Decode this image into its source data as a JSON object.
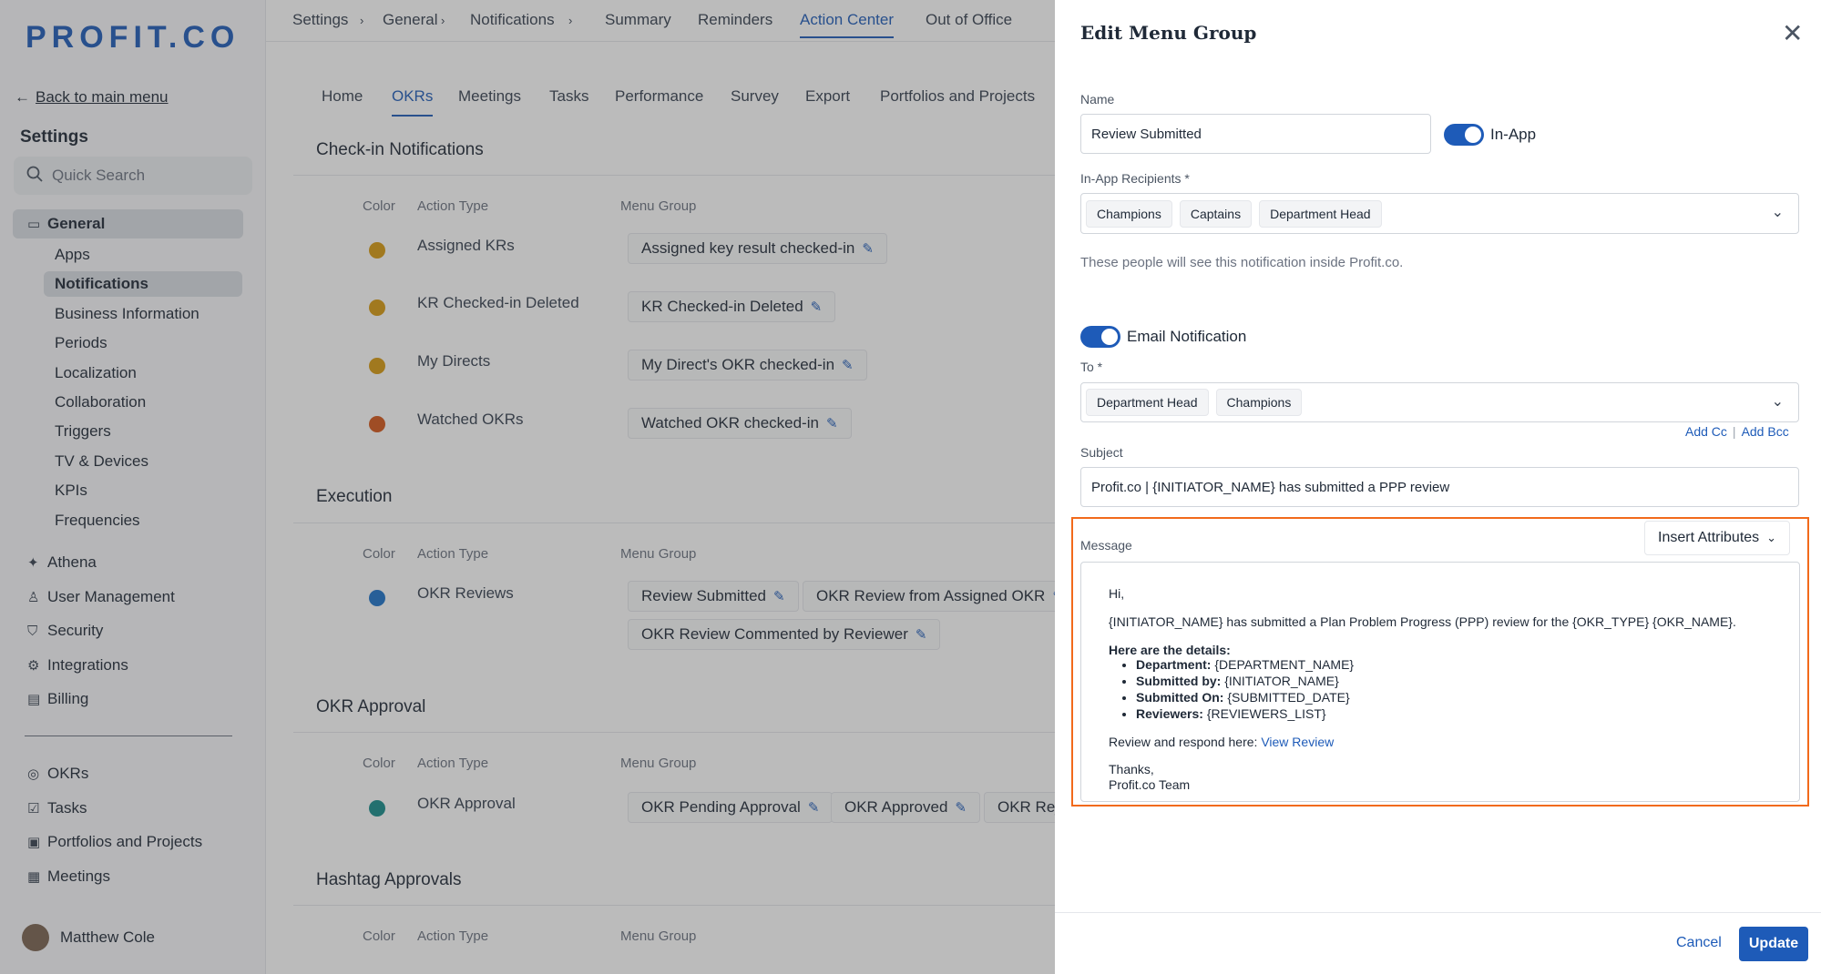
{
  "sidebar": {
    "logo": "PROFIT.CO",
    "back_link": "Back to main menu",
    "settings_title": "Settings",
    "search_placeholder": "Quick Search",
    "general": "General",
    "sub_items": [
      "Apps",
      "Notifications",
      "Business Information",
      "Periods",
      "Localization",
      "Collaboration",
      "Triggers",
      "TV & Devices",
      "KPIs",
      "Frequencies"
    ],
    "items": [
      "Athena",
      "User Management",
      "Security",
      "Integrations",
      "Billing"
    ],
    "items2": [
      "OKRs",
      "Tasks",
      "Portfolios and Projects",
      "Meetings"
    ],
    "user_name": "Matthew Cole"
  },
  "topnav": {
    "breadcrumb": [
      "Settings",
      "General",
      "Notifications"
    ],
    "tabs": [
      "Summary",
      "Reminders",
      "Action Center",
      "Out of Office"
    ]
  },
  "subtabs": [
    "Home",
    "OKRs",
    "Meetings",
    "Tasks",
    "Performance",
    "Survey",
    "Export",
    "Portfolios and Projects"
  ],
  "columns": {
    "color": "Color",
    "action_type": "Action Type",
    "menu_group": "Menu Group"
  },
  "sections": {
    "checkin": {
      "title": "Check-in Notifications",
      "rows": [
        {
          "action": "Assigned KRs",
          "chips": [
            "Assigned key result checked-in"
          ]
        },
        {
          "action": "KR Checked-in Deleted",
          "chips": [
            "KR Checked-in Deleted"
          ]
        },
        {
          "action": "My Directs",
          "chips": [
            "My Direct's OKR checked-in"
          ]
        },
        {
          "action": "Watched OKRs",
          "chips": [
            "Watched OKR checked-in"
          ]
        }
      ]
    },
    "execution": {
      "title": "Execution",
      "rows": [
        {
          "action": "OKR Reviews",
          "chips": [
            "Review Submitted",
            "OKR Review from Assigned OKR",
            "OKR Review Commented by Reviewer"
          ]
        }
      ]
    },
    "approval": {
      "title": "OKR Approval",
      "rows": [
        {
          "action": "OKR Approval",
          "chips": [
            "OKR Pending Approval",
            "OKR Approved",
            "OKR Reje"
          ]
        }
      ]
    },
    "hashtag": {
      "title": "Hashtag Approvals"
    }
  },
  "colors": {
    "accent": "#1e5bb8",
    "highlight": "#f26a1b",
    "dot_amber": "#d89a10",
    "dot_orange": "#d4561a",
    "dot_blue": "#1d72c9",
    "dot_teal": "#168d8a"
  },
  "panel": {
    "title": "Edit Menu Group",
    "name_label": "Name",
    "name_value": "Review Submitted",
    "inapp_label": "In-App",
    "inapp_recipients_label": "In-App Recipients *",
    "inapp_recipients": [
      "Champions",
      "Captains",
      "Department Head"
    ],
    "helper": "These people will see this notification inside Profit.co.",
    "email_label": "Email Notification",
    "to_label": "To *",
    "to_recipients": [
      "Department Head",
      "Champions"
    ],
    "add_cc": "Add Cc",
    "add_bcc": "Add Bcc",
    "subject_label": "Subject",
    "subject_value": "Profit.co | {INITIATOR_NAME} has submitted a PPP review",
    "message_label": "Message",
    "insert_attributes": "Insert Attributes",
    "message": {
      "greeting": "Hi,",
      "line1": "{INITIATOR_NAME} has submitted a Plan Problem Progress (PPP) review for the {OKR_TYPE} {OKR_NAME}.",
      "details_heading": "Here are the details:",
      "details": [
        {
          "label": "Department:",
          "value": "{DEPARTMENT_NAME}"
        },
        {
          "label": "Submitted by:",
          "value": "{INITIATOR_NAME}"
        },
        {
          "label": "Submitted On:",
          "value": "{SUBMITTED_DATE}"
        },
        {
          "label": "Reviewers:",
          "value": "{REVIEWERS_LIST}"
        }
      ],
      "respond_text": "Review and respond here: ",
      "respond_link": "View Review",
      "thanks": "Thanks,",
      "team": "Profit.co Team"
    },
    "cancel": "Cancel",
    "update": "Update"
  }
}
